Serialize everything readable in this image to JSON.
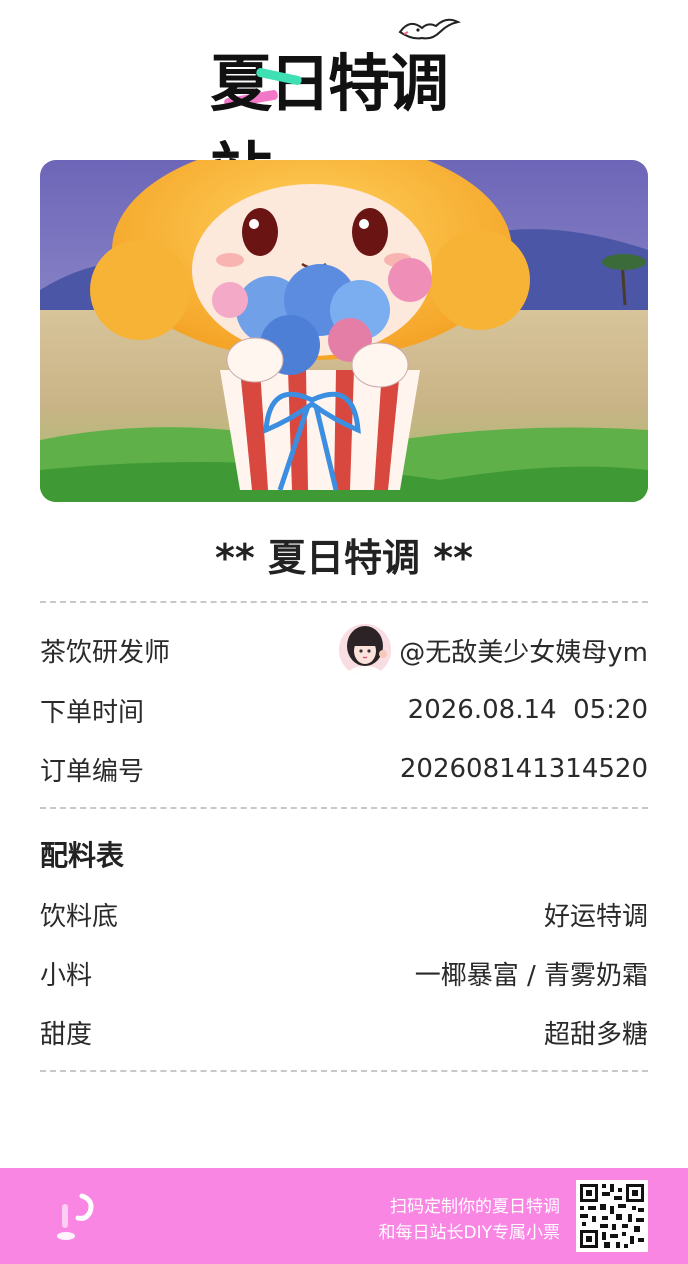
{
  "brand": {
    "logo_text": "夏日特调站"
  },
  "drink": {
    "title": "** 夏日特调 **"
  },
  "order_info": {
    "creator_label": "茶饮研发师",
    "creator_name": "@无敌美少女姨母ym",
    "time_label": "下单时间",
    "time_value": "2026.08.14  05:20",
    "number_label": "订单编号",
    "number_value": "202608141314520"
  },
  "ingredients": {
    "section_title": "配料表",
    "items": [
      {
        "label": "饮料底",
        "value": "好运特调"
      },
      {
        "label": "小料",
        "value": "一椰暴富 / 青雾奶霜"
      },
      {
        "label": "甜度",
        "value": "超甜多糖"
      }
    ]
  },
  "footer": {
    "line1": "扫码定制你的夏日特调",
    "line2": "和每日站长DIY专属小票",
    "background_color": "#fa86e4"
  },
  "colors": {
    "accent_pink": "#f277c8",
    "accent_green": "#3ee0b4"
  }
}
